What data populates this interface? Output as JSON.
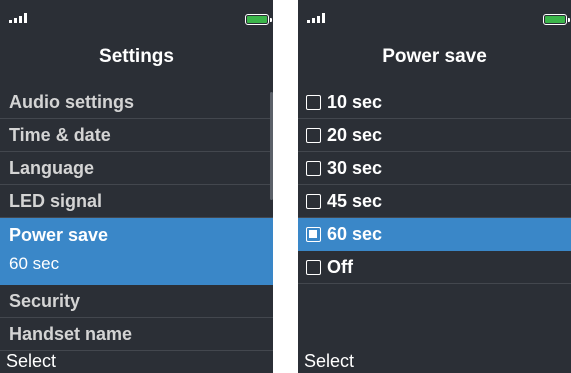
{
  "left_screen": {
    "title": "Settings",
    "items": [
      {
        "label": "Audio settings"
      },
      {
        "label": "Time & date"
      },
      {
        "label": "Language"
      },
      {
        "label": "LED signal"
      },
      {
        "label": "Power save",
        "value": "60 sec",
        "selected": true
      },
      {
        "label": "Security"
      },
      {
        "label": "Handset name"
      }
    ],
    "softkey": "Select"
  },
  "right_screen": {
    "title": "Power save",
    "options": [
      {
        "label": "10 sec",
        "checked": false
      },
      {
        "label": "20 sec",
        "checked": false
      },
      {
        "label": "30 sec",
        "checked": false
      },
      {
        "label": "45 sec",
        "checked": false
      },
      {
        "label": "60 sec",
        "checked": true
      },
      {
        "label": "Off",
        "checked": false
      }
    ],
    "softkey": "Select"
  },
  "colors": {
    "background": "#2b2f36",
    "highlight": "#3a87c8",
    "battery": "#3bb54a"
  },
  "icons": [
    "signal-icon",
    "battery-icon",
    "checkbox-icon"
  ]
}
